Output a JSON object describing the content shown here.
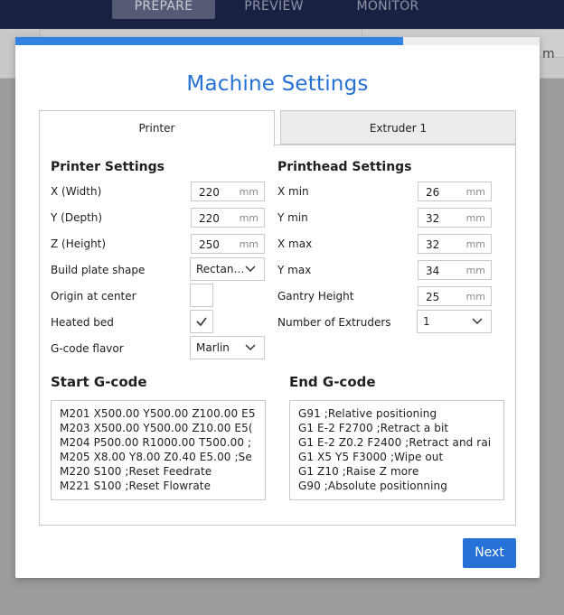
{
  "background": {
    "tabs": [
      {
        "label": "PREPARE",
        "active": true
      },
      {
        "label": "PREVIEW",
        "active": false
      },
      {
        "label": "MONITOR",
        "active": false
      }
    ],
    "right_fragment": "m"
  },
  "dialog": {
    "title": "Machine Settings",
    "progress": 0.74,
    "tabs": [
      {
        "label": "Printer",
        "active": true
      },
      {
        "label": "Extruder 1",
        "active": false
      }
    ],
    "printer_settings": {
      "title": "Printer Settings",
      "x_label": "X (Width)",
      "x_value": "220",
      "x_unit": "mm",
      "y_label": "Y (Depth)",
      "y_value": "220",
      "y_unit": "mm",
      "z_label": "Z (Height)",
      "z_value": "250",
      "z_unit": "mm",
      "shape_label": "Build plate shape",
      "shape_value": "Rectan…",
      "origin_label": "Origin at center",
      "origin_checked": false,
      "heated_label": "Heated bed",
      "heated_checked": true,
      "flavor_label": "G-code flavor",
      "flavor_value": "Marlin"
    },
    "printhead_settings": {
      "title": "Printhead Settings",
      "xmin_label": "X min",
      "xmin_value": "26",
      "xmin_unit": "mm",
      "ymin_label": "Y min",
      "ymin_value": "32",
      "ymin_unit": "mm",
      "xmax_label": "X max",
      "xmax_value": "32",
      "xmax_unit": "mm",
      "ymax_label": "Y max",
      "ymax_value": "34",
      "ymax_unit": "mm",
      "gantry_label": "Gantry Height",
      "gantry_value": "25",
      "gantry_unit": "mm",
      "extruders_label": "Number of Extruders",
      "extruders_value": "1"
    },
    "start_gcode": {
      "title": "Start G-code",
      "lines": [
        "M201 X500.00 Y500.00 Z100.00 E5",
        "M203 X500.00 Y500.00 Z10.00 E5(",
        "M204 P500.00 R1000.00 T500.00 ;",
        "M205 X8.00 Y8.00 Z0.40 E5.00 ;Se",
        "M220 S100 ;Reset Feedrate",
        "M221 S100 ;Reset Flowrate"
      ]
    },
    "end_gcode": {
      "title": "End G-code",
      "lines": [
        "G91 ;Relative positioning",
        "G1 E-2 F2700 ;Retract a bit",
        "G1 E-2 Z0.2 F2400 ;Retract and rai",
        "G1 X5 Y5 F3000 ;Wipe out",
        "G1 Z10 ;Raise Z more",
        "G90 ;Absolute positionning"
      ]
    },
    "next_label": "Next"
  },
  "colors": {
    "accent": "#2571d6",
    "progress_fill": "#3282e2",
    "topbar": "#1a2040"
  },
  "icons": {
    "chevron": "chevron-down-icon",
    "check": "check-icon"
  }
}
